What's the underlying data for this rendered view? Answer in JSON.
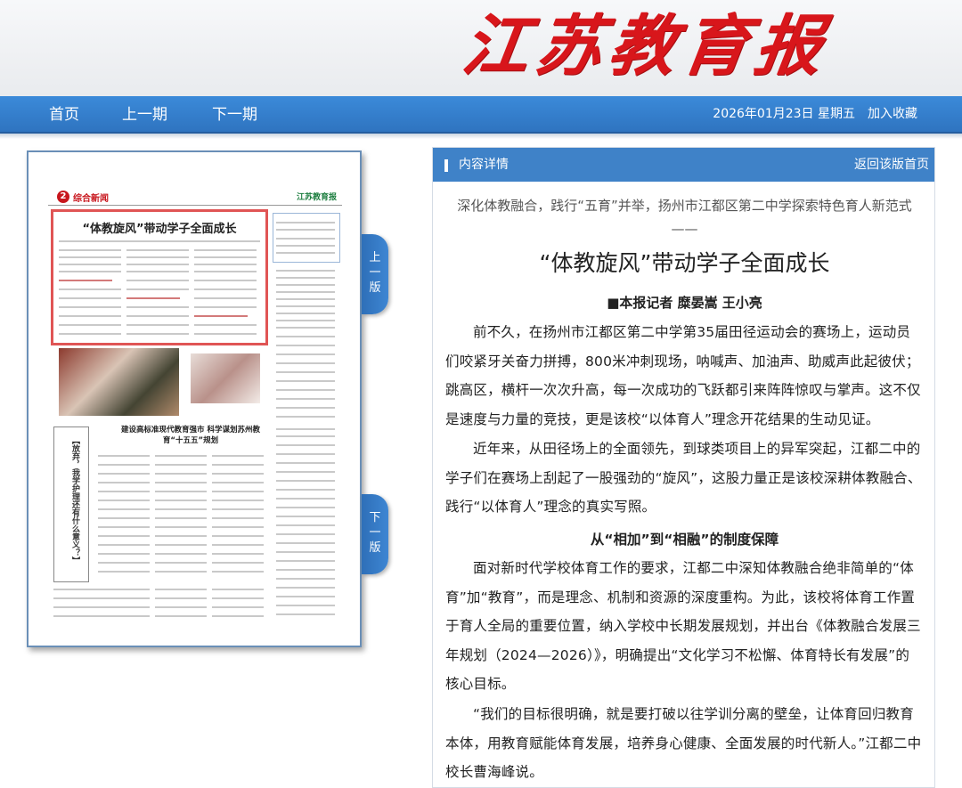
{
  "masthead": {
    "logo_text": "江苏教育报"
  },
  "nav": {
    "home": "首页",
    "prev_issue": "上一期",
    "next_issue": "下一期",
    "date": "2026年01月23日 星期五",
    "add_favorite": "加入收藏"
  },
  "thumbnail": {
    "page_number": "2",
    "section": "综合新闻",
    "logo_small": "江苏教育报",
    "headline": "“体教旋风”带动学子全面成长",
    "bottom_headline": "建设高标准现代教育强市 科学谋划苏州教育“十五五”规划",
    "vertical_headline": "【放弃，我学护理还有什么意义？】"
  },
  "tabs": {
    "prev_page": "上一版",
    "next_page": "下一版"
  },
  "content": {
    "header_label": "内容详情",
    "back_link": "返回该版首页",
    "subtitle": "深化体教融合，践行“五育”并举，扬州市江都区第二中学探索特色育人新范式——",
    "title": "“体教旋风”带动学子全面成长",
    "byline": "■本报记者 糜晏嵩 王小亮",
    "paragraphs": [
      "前不久，在扬州市江都区第二中学第35届田径运动会的赛场上，运动员们咬紧牙关奋力拼搏，800米冲刺现场，呐喊声、加油声、助威声此起彼伏；跳高区，横杆一次次升高，每一次成功的飞跃都引来阵阵惊叹与掌声。这不仅是速度与力量的竞技，更是该校“以体育人”理念开花结果的生动见证。",
      "近年来，从田径场上的全面领先，到球类项目上的异军突起，江都二中的学子们在赛场上刮起了一股强劲的“旋风”，这股力量正是该校深耕体教融合、践行“以体育人”理念的真实写照。"
    ],
    "section_heading": "从“相加”到“相融”的制度保障",
    "paragraphs2": [
      "面对新时代学校体育工作的要求，江都二中深知体教融合绝非简单的“体育”加“教育”，而是理念、机制和资源的深度重构。为此，该校将体育工作置于育人全局的重要位置，纳入学校中长期发展规划，并出台《体教融合发展三年规划（2024—2026）》，明确提出“文化学习不松懈、体育特长有发展”的核心目标。",
      "“我们的目标很明确，就是要打破以往学训分离的壁垒，让体育回归教育本体，用教育赋能体育发展，培养身心健康、全面发展的时代新人。”江都二中校长曹海峰说。"
    ]
  },
  "colors": {
    "nav_blue": "#3579c8",
    "logo_red": "#d8161b",
    "highlight_red": "#e05555"
  }
}
